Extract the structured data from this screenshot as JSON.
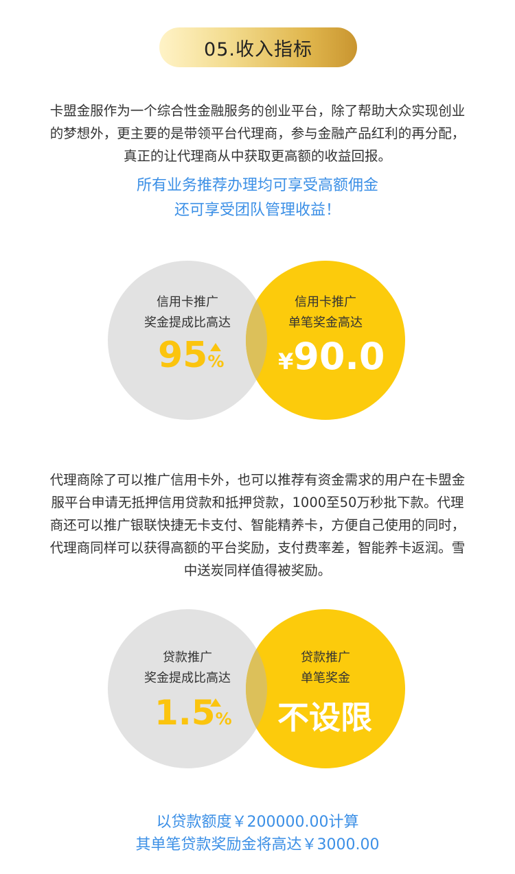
{
  "header": {
    "title": "05.收入指标"
  },
  "intro": {
    "lines": [
      "卡盟金服作为一个综合性金融服务的创业平台，除了帮助大众实现创业",
      "的梦想外，更主要的是带领平台代理商，参与金融产品红利的再分配，",
      "真正的让代理商从中获取更高额的收益回报。"
    ]
  },
  "highlight": {
    "line1": "所有业务推荐办理均可享受高额佣金",
    "line2": "还可享受团队管理收益！"
  },
  "venn1": {
    "left_line1": "信用卡推广",
    "left_line2": "奖金提成比高达",
    "left_value": "95",
    "left_unit": "%",
    "right_line1": "信用卡推广",
    "right_line2": "单笔奖金高达",
    "right_currency": "¥",
    "right_value": "90.0"
  },
  "middle": {
    "lines": [
      "代理商除了可以推广信用卡外，也可以推荐有资金需求的用户在卡盟金",
      "服平台申请无抵押信用贷款和抵押贷款，1000至50万秒批下款。代理",
      "商还可以推广银联快捷无卡支付、智能精养卡，方便自己使用的同时，",
      "代理商同样可以获得高额的平台奖励，支付费率差，智能养卡返润。雪",
      "中送炭同样值得被奖励。"
    ]
  },
  "venn2": {
    "left_line1": "贷款推广",
    "left_line2": "奖金提成比高达",
    "left_value": "1.5",
    "left_unit": "%",
    "right_line1": "贷款推广",
    "right_line2": "单笔奖金",
    "right_value": "不设限"
  },
  "footer": {
    "line1": "以贷款额度￥200000.00计算",
    "line2": "其单笔贷款奖励金将高达￥3000.00"
  },
  "colors": {
    "accent_blue": "#3b8fe6",
    "gold": "#fccb0c",
    "gray": "#e2e2e2"
  }
}
